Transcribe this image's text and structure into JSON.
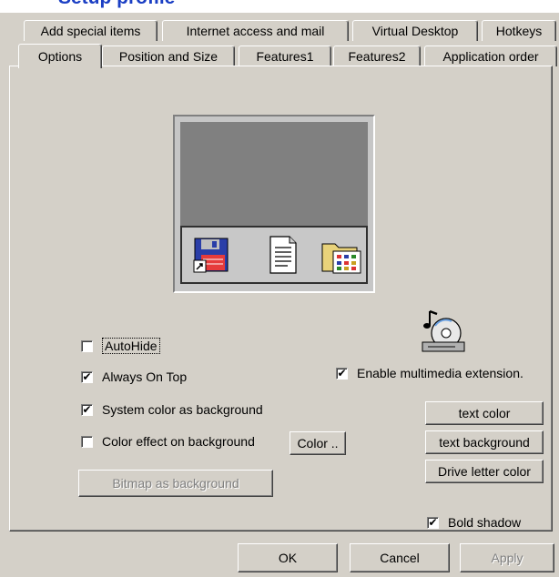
{
  "window": {
    "title": "Setup profile"
  },
  "tabs_back": [
    "Add special items",
    "Internet access and mail",
    "Virtual Desktop",
    "Hotkeys"
  ],
  "tabs_front": [
    "Options",
    "Position and Size",
    "Features1",
    "Features2",
    "Application order"
  ],
  "active_tab": "Options",
  "preview": {
    "icons": [
      "floppy-disk-icon",
      "document-icon",
      "folder-icon"
    ]
  },
  "multimedia_icon": "cd-music-icon",
  "checkboxes": {
    "autohide": {
      "label": "AutoHide",
      "checked": false
    },
    "always_on_top": {
      "label": "Always On Top",
      "checked": true
    },
    "system_color": {
      "label": "System color as background",
      "checked": true
    },
    "color_effect": {
      "label": "Color effect on background",
      "checked": false
    },
    "enable_multimedia": {
      "label": "Enable multimedia extension.",
      "checked": true
    },
    "bold_shadow": {
      "label": "Bold shadow",
      "checked": true
    }
  },
  "buttons": {
    "color": "Color ..",
    "bitmap": "Bitmap as background",
    "text_color": "text color",
    "text_background": "text background",
    "drive_letter_color": "Drive letter color",
    "ok": "OK",
    "cancel": "Cancel",
    "apply": "Apply"
  }
}
